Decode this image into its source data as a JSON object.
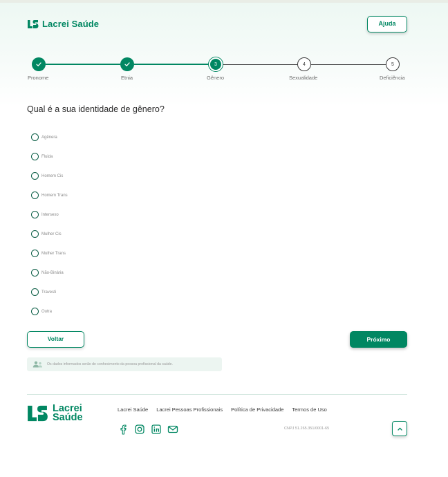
{
  "header": {
    "brand": "Lacrei Saúde",
    "help_label": "Ajuda"
  },
  "stepper": {
    "steps": [
      {
        "label": "Pronome",
        "number": "1",
        "state": "done"
      },
      {
        "label": "Etnia",
        "number": "2",
        "state": "done"
      },
      {
        "label": "Gênero",
        "number": "3",
        "state": "current"
      },
      {
        "label": "Sexualidade",
        "number": "4",
        "state": "todo"
      },
      {
        "label": "Deficiência",
        "number": "5",
        "state": "todo"
      }
    ]
  },
  "question": {
    "title": "Qual é a sua identidade de gênero?",
    "options": [
      "Agênera",
      "Fluida",
      "Homem Cis",
      "Homem Trans",
      "Intersexo",
      "Mulher Cis",
      "Mulher Trans",
      "Não-Binária",
      "Travesti",
      "Outra"
    ]
  },
  "actions": {
    "back_label": "Voltar",
    "next_label": "Próximo"
  },
  "notice": {
    "text": "Os dados informados serão de conhecimento da pessoa profissional da saúde."
  },
  "footer": {
    "logo_line1": "Lacrei",
    "logo_line2": "Saúde",
    "links": [
      "Lacrei Saúde",
      "Lacrei Pessoas Profissionais",
      "Política de Privacidade",
      "Termos de Uso"
    ],
    "socials": [
      "facebook-icon",
      "instagram-icon",
      "linkedin-icon",
      "mail-icon"
    ],
    "cnpj": "CNPJ 51.265.351/0001-65"
  },
  "colors": {
    "brand": "#018762",
    "radio": "#0b5e46",
    "notice_bg": "#ecf5f1"
  }
}
